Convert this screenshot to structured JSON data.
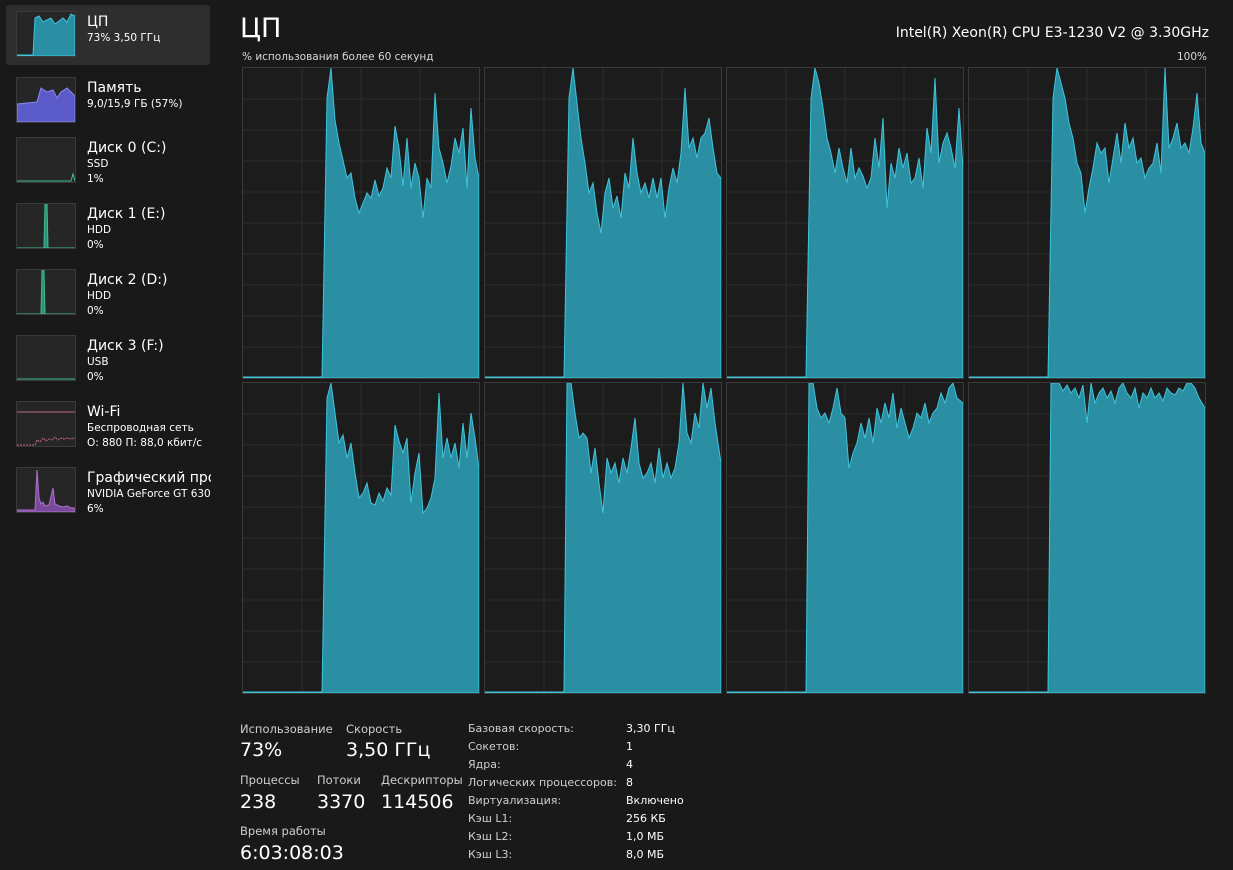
{
  "sidebar": {
    "items": [
      {
        "title": "ЦП",
        "sub1": "73% 3,50 ГГц",
        "sub2": "",
        "sub3": ""
      },
      {
        "title": "Память",
        "sub1": "9,0/15,9 ГБ (57%)",
        "sub2": "",
        "sub3": ""
      },
      {
        "title": "Диск 0 (C:)",
        "sub1": "SSD",
        "sub2": "1%",
        "sub3": ""
      },
      {
        "title": "Диск 1 (E:)",
        "sub1": "HDD",
        "sub2": "0%",
        "sub3": ""
      },
      {
        "title": "Диск 2 (D:)",
        "sub1": "HDD",
        "sub2": "0%",
        "sub3": ""
      },
      {
        "title": "Диск 3 (F:)",
        "sub1": "USB",
        "sub2": "0%",
        "sub3": ""
      },
      {
        "title": "Wi-Fi",
        "sub1": "Беспроводная сеть",
        "sub2": "О: 880 П: 88,0 кбит/с",
        "sub3": ""
      },
      {
        "title": "Графический про",
        "sub1": "NVIDIA GeForce GT 630",
        "sub2": "6%",
        "sub3": ""
      }
    ]
  },
  "header": {
    "title": "ЦП",
    "cpu_model": "Intel(R) Xeon(R) CPU E3-1230 V2 @ 3.30GHz",
    "graph_caption": "% использования более 60 секунд",
    "graph_max": "100%"
  },
  "colors": {
    "cpu_fill": "#2a8fa3",
    "cpu_line": "#3fc4dc",
    "memory_fill": "#5a5ac8",
    "gpu_line": "#b070d0",
    "wifi_line": "#c06890",
    "background": "#191919"
  },
  "stats": {
    "usage_label": "Использование",
    "usage_value": "73%",
    "speed_label": "Скорость",
    "speed_value": "3,50 ГГц",
    "processes_label": "Процессы",
    "processes_value": "238",
    "threads_label": "Потоки",
    "threads_value": "3370",
    "handles_label": "Дескрипторы",
    "handles_value": "114506",
    "uptime_label": "Время работы",
    "uptime_value": "6:03:08:03"
  },
  "specs": [
    {
      "label": "Базовая скорость:",
      "value": "3,30 ГГц"
    },
    {
      "label": "Сокетов:",
      "value": "1"
    },
    {
      "label": "Ядра:",
      "value": "4"
    },
    {
      "label": "Логических процессоров:",
      "value": "8"
    },
    {
      "label": "Виртуализация:",
      "value": "Включено"
    },
    {
      "label": "Кэш L1:",
      "value": "256 КБ"
    },
    {
      "label": "Кэш L2:",
      "value": "1,0 МБ"
    },
    {
      "label": "Кэш L3:",
      "value": "8,0 МБ"
    }
  ]
}
